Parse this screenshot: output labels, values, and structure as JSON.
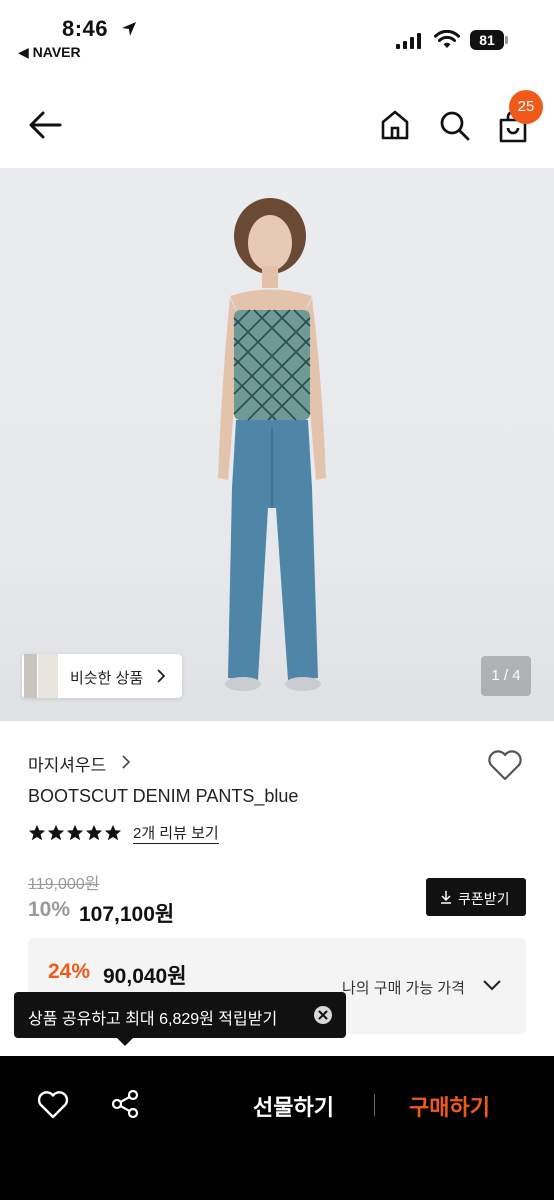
{
  "status_bar": {
    "time": "8:46",
    "back_app": "◀ NAVER",
    "battery": "81"
  },
  "header": {
    "cart_count": "25"
  },
  "gallery": {
    "similar_label": "비슷한 상품",
    "page_indicator": "1 / 4"
  },
  "product": {
    "brand": "마지셔우드",
    "name": "BOOTSCUT DENIM PANTS_blue",
    "rating_stars": 5,
    "review_link": "2개 리뷰 보기",
    "original_price": "119,000원",
    "discount_rate": "10%",
    "sale_price": "107,100원",
    "coupon_label": "쿠폰받기"
  },
  "best_price": {
    "rate": "24%",
    "price": "90,040원",
    "label": "나의 구매 가능 가격"
  },
  "toast": {
    "text": "상품 공유하고 최대 6,829원 적립받기"
  },
  "bottom_bar": {
    "gift_label": "선물하기",
    "buy_label": "구매하기"
  },
  "colors": {
    "accent": "#f05a19",
    "dark": "#111111"
  }
}
